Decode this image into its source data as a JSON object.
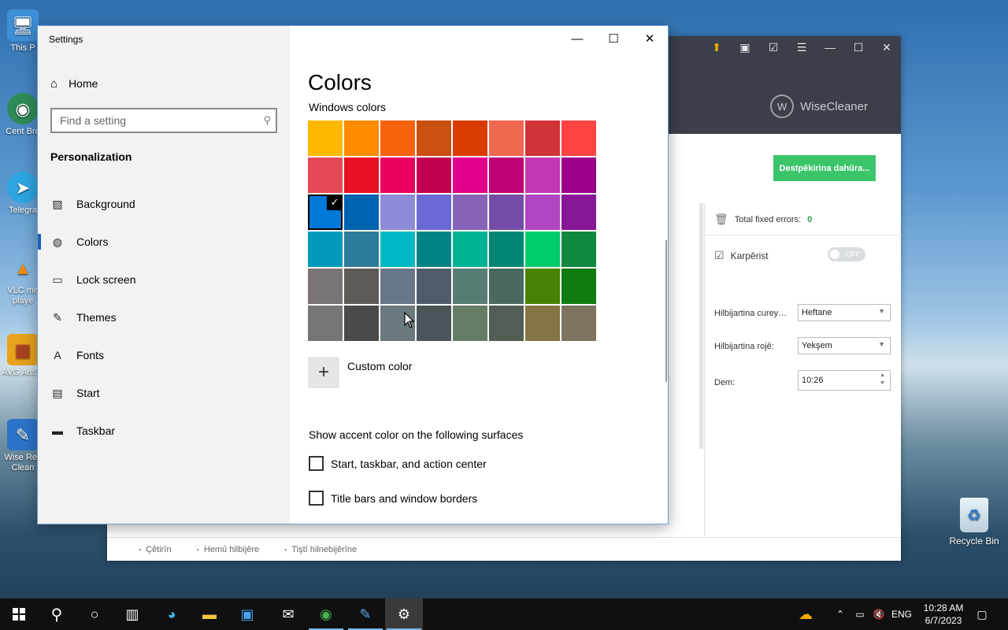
{
  "desktop": {
    "icons": [
      {
        "label": "This P",
        "glyph": "🖥"
      },
      {
        "label": "Cent Bro",
        "glyph": "◉"
      },
      {
        "label": "Telegra",
        "glyph": "➤"
      },
      {
        "label": "VLC me playe",
        "glyph": "▲"
      },
      {
        "label": "AVG AntiVi",
        "glyph": "▦"
      },
      {
        "label": "Wise Rec Clean",
        "glyph": "✎"
      }
    ],
    "recycle_bin": "Recycle Bin"
  },
  "wise": {
    "logo_text": "WiseCleaner",
    "logo_mark": "W",
    "primary_button": "Destpêkirina dahûra...",
    "total_errors_label": "Total fixed errors:",
    "total_errors_value": "0",
    "schedule_label": "Karpêrist",
    "toggle_text": "OFF",
    "freq_label": "Hilbijartina curey…",
    "freq_value": "Heftane",
    "day_label": "Hilbijartina rojê:",
    "day_value": "Yekşem",
    "time_label": "Dem:",
    "time_value": "10:26",
    "footer": [
      "Çêtirîn",
      "Hemû hilbijêre",
      "Tiştî hilnebijêrîne"
    ]
  },
  "settings": {
    "window_title": "Settings",
    "home": "Home",
    "search_placeholder": "Find a setting",
    "section": "Personalization",
    "nav": [
      {
        "label": "Background",
        "icon": "background-icon",
        "glyph": "▨"
      },
      {
        "label": "Colors",
        "icon": "palette-icon",
        "glyph": "◍"
      },
      {
        "label": "Lock screen",
        "icon": "lock-screen-icon",
        "glyph": "▭"
      },
      {
        "label": "Themes",
        "icon": "themes-icon",
        "glyph": "✎"
      },
      {
        "label": "Fonts",
        "icon": "fonts-icon",
        "glyph": "A"
      },
      {
        "label": "Start",
        "icon": "start-icon",
        "glyph": "▤"
      },
      {
        "label": "Taskbar",
        "icon": "taskbar-icon",
        "glyph": "▬"
      }
    ],
    "active_nav": "Colors",
    "page_title": "Colors",
    "palette_title": "Windows colors",
    "palette": [
      [
        "#FFB900",
        "#FF8C00",
        "#F7630C",
        "#CA5010",
        "#DA3B01",
        "#EF6950",
        "#D13438",
        "#FF4343"
      ],
      [
        "#E74856",
        "#E81123",
        "#EA005E",
        "#C30052",
        "#E3008C",
        "#BF0077",
        "#C239B3",
        "#9A0089"
      ],
      [
        "#0078D7",
        "#0063B1",
        "#8E8CD8",
        "#6B69D6",
        "#8764B8",
        "#744DA9",
        "#B146C2",
        "#881798"
      ],
      [
        "#0099BC",
        "#2D7D9A",
        "#00B7C3",
        "#038387",
        "#00B294",
        "#018574",
        "#00CC6A",
        "#10893E"
      ],
      [
        "#7A7574",
        "#5D5A58",
        "#68768A",
        "#515C6B",
        "#567C73",
        "#486860",
        "#498205",
        "#107C10"
      ],
      [
        "#767676",
        "#4C4A48",
        "#69797E",
        "#4A5459",
        "#647C64",
        "#525E54",
        "#847545",
        "#7E735F"
      ]
    ],
    "selected": {
      "row": 2,
      "col": 0
    },
    "check_glyph": "✓",
    "custom_color": "Custom color",
    "surfaces_title": "Show accent color on the following surfaces",
    "checkboxes": [
      "Start, taskbar, and action center",
      "Title bars and window borders"
    ],
    "controls": {
      "minimize": "—",
      "maximize": "☐",
      "close": "✕"
    }
  },
  "taskbar": {
    "lang": "ENG",
    "time": "10:28 AM",
    "date": "6/7/2023"
  }
}
